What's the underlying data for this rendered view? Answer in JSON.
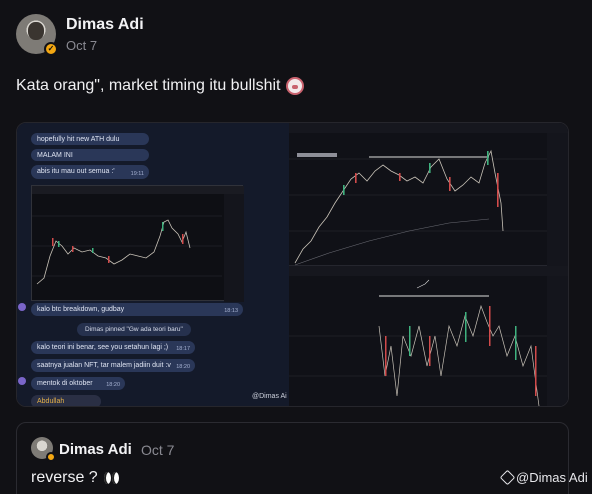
{
  "post": {
    "author": "Dimas Adi",
    "date": "Oct 7",
    "text": "Kata orang\", market timing itu bullshit",
    "emoji": "pig-face-emoji"
  },
  "media": {
    "chat_messages": [
      {
        "text": "hopefully hit new ATH dulu",
        "time": ""
      },
      {
        "text": "MALAM INI",
        "time": ""
      },
      {
        "text": "abis itu mau out semua :'",
        "time": "19:11"
      },
      {
        "text": "kalo btc breakdown, gudbay",
        "time": "18:13"
      },
      {
        "text": "kalo teori ini benar, see you setahun lagi ;)",
        "time": "18:17"
      },
      {
        "text": "saatnya jualan NFT, tar malem jadiin duit :v",
        "time": "18:20"
      },
      {
        "text": "mentok di oktober",
        "time": "18:20"
      }
    ],
    "pinned": "Dimas pinned \"Gw ada teori baru\"",
    "sender": "Abdullah",
    "inner_watermark": "@Dimas Ai"
  },
  "quote": {
    "author": "Dimas Adi",
    "date": "Oct 7",
    "text": "reverse ?",
    "emoji": "eyes-emoji"
  },
  "watermark": "@Dimas Adi"
}
